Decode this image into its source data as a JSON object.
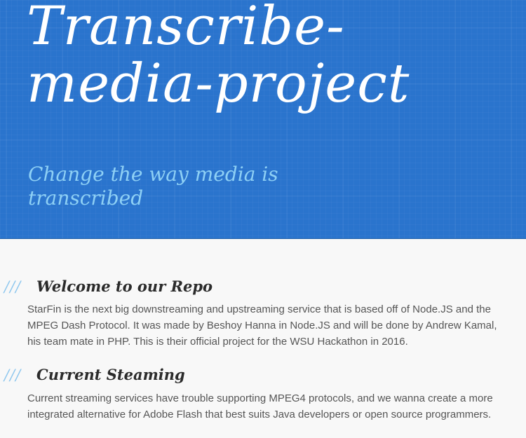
{
  "header": {
    "title": "Transcribe-media-project",
    "tagline": "Change the way media is transcribed",
    "background_color": "#2a74cd",
    "title_color": "#ffffff",
    "tagline_color": "#8ed0f5"
  },
  "sections": [
    {
      "marker": "///",
      "heading": "Welcome to our Repo",
      "body": "StarFin is the next big downstreaming and upstreaming service that is based off of Node.JS and the MPEG Dash Protocol. It was made by Beshoy Hanna in Node.JS and will be done by Andrew Kamal, his team mate in PHP. This is their official project for the WSU Hackathon in 2016."
    },
    {
      "marker": "///",
      "heading": "Current Steaming",
      "body": "Current streaming services have trouble supporting MPEG4 protocols, and we wanna create a more integrated alternative for Adobe Flash that best suits Java developers or open source programmers."
    }
  ],
  "colors": {
    "page_background": "#f8f8f8",
    "marker": "#8ec7ee",
    "heading": "#2b2b2b",
    "body_text": "#555555"
  }
}
